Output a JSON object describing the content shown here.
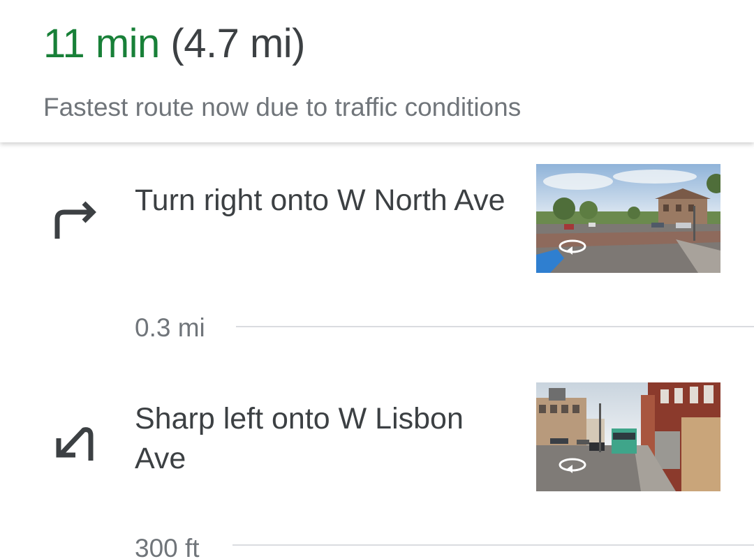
{
  "summary": {
    "duration": "11 min",
    "distance": "(4.7 mi)",
    "note": "Fastest route now due to traffic conditions",
    "accent_color": "#188038"
  },
  "steps": [
    {
      "instruction": "Turn right onto W North Ave",
      "icon": "turn-right-icon",
      "distance": "0.3 mi",
      "thumbnail": "street-view-thumbnail"
    },
    {
      "instruction": "Sharp left onto W Lisbon Ave",
      "icon": "sharp-left-icon",
      "distance": "300 ft",
      "thumbnail": "street-view-thumbnail"
    }
  ]
}
